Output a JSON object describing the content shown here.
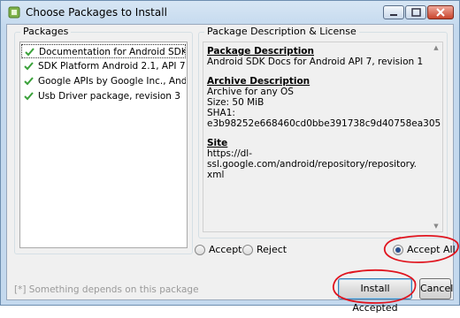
{
  "window": {
    "title": "Choose Packages to Install"
  },
  "packages": {
    "legend": "Packages",
    "items": [
      {
        "label": "Documentation for Android SDK...",
        "accepted": true,
        "selected": true
      },
      {
        "label": "SDK Platform Android 2.1, API 7, ...",
        "accepted": true,
        "selected": false
      },
      {
        "label": "Google APIs by Google Inc., And...",
        "accepted": true,
        "selected": false
      },
      {
        "label": "Usb Driver package, revision 3",
        "accepted": true,
        "selected": false
      }
    ]
  },
  "description": {
    "legend": "Package Description & License",
    "package_heading": "Package Description",
    "package_text": "Android SDK Docs for Android API 7, revision 1",
    "archive_heading": "Archive Description",
    "archive_lines": [
      "Archive for any OS",
      "Size: 50 MiB",
      "SHA1: e3b98252e668460cd0bbe391738c9d40758ea305"
    ],
    "site_heading": "Site",
    "site_lines": [
      "https://dl-ssl.google.com/android/repository/repository.",
      "xml"
    ]
  },
  "options": {
    "accept": "Accept",
    "reject": "Reject",
    "accept_all": "Accept All",
    "selected": "accept_all"
  },
  "footer": {
    "status": "[*] Something depends on this package",
    "install_label": "Install Accepted",
    "cancel_label": "Cancel"
  },
  "colors": {
    "check": "#3aa13a",
    "annotation": "#e0141e"
  }
}
